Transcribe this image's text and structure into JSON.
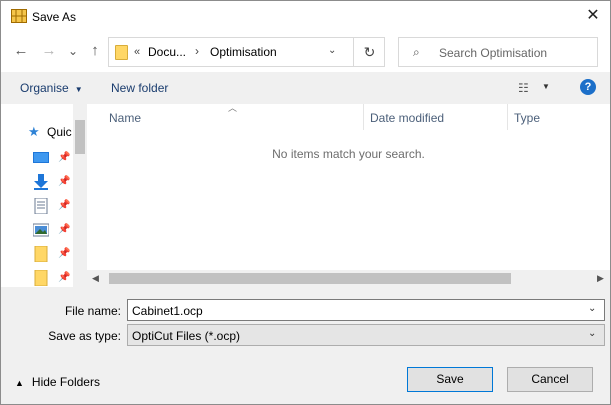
{
  "window": {
    "title": "Save As",
    "close_glyph": "✕"
  },
  "nav": {
    "back_glyph": "←",
    "forward_glyph": "→",
    "recent_glyph": "⌄",
    "up_glyph": "↑"
  },
  "address": {
    "overflow_glyph": "«",
    "crumbs": [
      "Docu...",
      "Optimisation"
    ],
    "separator": "›",
    "dropdown_glyph": "⌄",
    "refresh_glyph": "↻"
  },
  "search": {
    "placeholder": "Search Optimisation",
    "icon_glyph": "⌕"
  },
  "toolbar": {
    "organise_label": "Organise",
    "organise_caret": "▼",
    "new_folder_label": "New folder",
    "view_glyph": "☷",
    "view_dropdown_glyph": "▼",
    "help_glyph": "?"
  },
  "nav_pane": {
    "quick_access_label": "Quic",
    "pin_glyph": "📌"
  },
  "columns": [
    "Name",
    "Date modified",
    "Type"
  ],
  "file_list": {
    "empty_message": "No items match your search."
  },
  "scroll": {
    "left_glyph": "◀",
    "right_glyph": "▶"
  },
  "form": {
    "file_name_label": "File name:",
    "file_name_value": "Cabinet1.ocp",
    "save_type_label": "Save as type:",
    "save_type_value": "OptiCut Files (*.ocp)",
    "dropdown_glyph": "⌄"
  },
  "footer": {
    "hide_folders_label": "Hide Folders",
    "hide_folders_glyph": "▲",
    "save_label": "Save",
    "cancel_label": "Cancel"
  }
}
